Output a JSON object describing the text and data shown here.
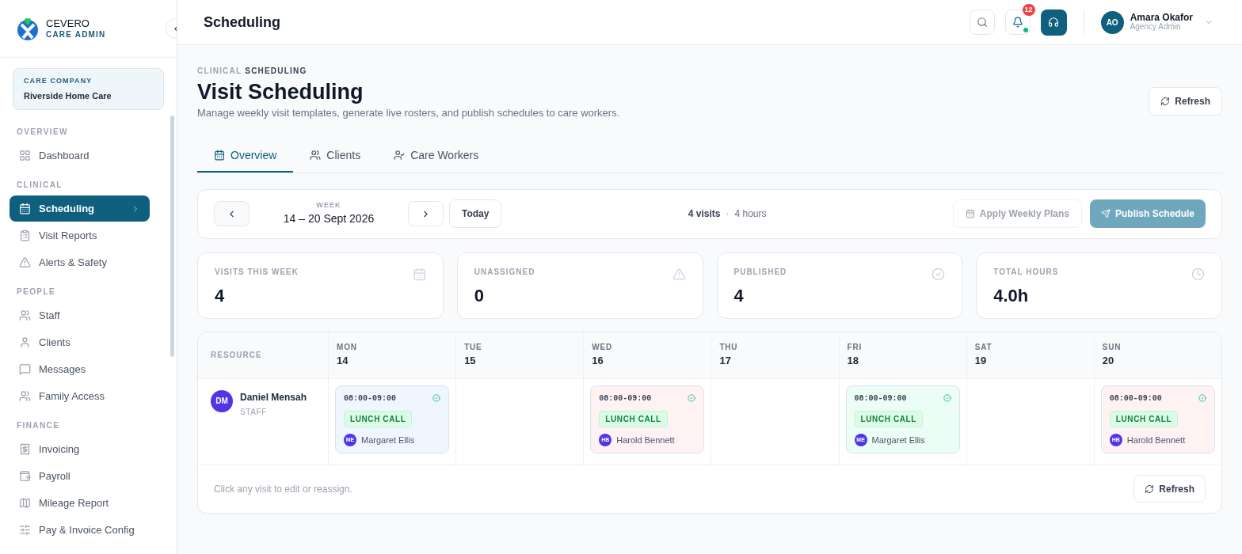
{
  "brand": {
    "name": "CEVERO",
    "subtitle": "CARE ADMIN"
  },
  "company": {
    "label": "CARE COMPANY",
    "name": "Riverside Home Care"
  },
  "sidebar": {
    "sections": [
      {
        "title": "OVERVIEW",
        "items": [
          {
            "label": "Dashboard",
            "selected": false
          }
        ]
      },
      {
        "title": "CLINICAL",
        "items": [
          {
            "label": "Scheduling",
            "selected": true
          },
          {
            "label": "Visit Reports",
            "selected": false
          },
          {
            "label": "Alerts & Safety",
            "selected": false
          }
        ]
      },
      {
        "title": "PEOPLE",
        "items": [
          {
            "label": "Staff",
            "selected": false
          },
          {
            "label": "Clients",
            "selected": false
          },
          {
            "label": "Messages",
            "selected": false
          },
          {
            "label": "Family Access",
            "selected": false
          }
        ]
      },
      {
        "title": "FINANCE",
        "items": [
          {
            "label": "Invoicing",
            "selected": false
          },
          {
            "label": "Payroll",
            "selected": false
          },
          {
            "label": "Mileage Report",
            "selected": false
          },
          {
            "label": "Pay & Invoice Config",
            "selected": false
          }
        ]
      }
    ]
  },
  "header": {
    "title": "Scheduling",
    "notification_count": "12",
    "user": {
      "initials": "AO",
      "name": "Amara Okafor",
      "role": "Agency Admin"
    }
  },
  "page": {
    "breadcrumb": [
      "CLINICAL",
      "SCHEDULING"
    ],
    "title": "Visit Scheduling",
    "subtitle": "Manage weekly visit templates, generate live rosters, and publish schedules to care workers.",
    "refresh": "Refresh"
  },
  "tabs": [
    {
      "label": "Overview",
      "selected": true
    },
    {
      "label": "Clients",
      "selected": false
    },
    {
      "label": "Care Workers",
      "selected": false
    }
  ],
  "week_bar": {
    "label": "WEEK",
    "range": "14 – 20 Sept 2026",
    "today": "Today",
    "visits": "4 visits",
    "separator": "·",
    "hours": "4 hours",
    "apply": "Apply Weekly Plans",
    "publish": "Publish Schedule"
  },
  "stats": [
    {
      "label": "VISITS THIS WEEK",
      "value": "4"
    },
    {
      "label": "UNASSIGNED",
      "value": "0"
    },
    {
      "label": "PUBLISHED",
      "value": "4"
    },
    {
      "label": "TOTAL HOURS",
      "value": "4.0h"
    }
  ],
  "roster": {
    "resource_heading": "RESOURCE",
    "days": [
      {
        "day": "MON",
        "date": "14"
      },
      {
        "day": "TUE",
        "date": "15"
      },
      {
        "day": "WED",
        "date": "16"
      },
      {
        "day": "THU",
        "date": "17"
      },
      {
        "day": "FRI",
        "date": "18"
      },
      {
        "day": "SAT",
        "date": "19"
      },
      {
        "day": "SUN",
        "date": "20"
      }
    ],
    "rows": [
      {
        "initials": "DM",
        "name": "Daniel Mensah",
        "role": "STAFF",
        "cells": [
          {
            "visit": {
              "time": "08:00-09:00",
              "tag": "LUNCH CALL",
              "client_initials": "ME",
              "client": "Margaret Ellis",
              "color": "#eff6ff"
            }
          },
          {},
          {
            "visit": {
              "time": "08:00-09:00",
              "tag": "LUNCH CALL",
              "client_initials": "HB",
              "client": "Harold Bennett",
              "color": "#fef2f2"
            }
          },
          {},
          {
            "visit": {
              "time": "08:00-09:00",
              "tag": "LUNCH CALL",
              "client_initials": "ME",
              "client": "Margaret Ellis",
              "color": "#ecfdf5"
            }
          },
          {},
          {
            "visit": {
              "time": "08:00-09:00",
              "tag": "LUNCH CALL",
              "client_initials": "HB",
              "client": "Harold Bennett",
              "color": "#fef2f2"
            }
          }
        ]
      }
    ],
    "hint": "Click any visit to edit or reassign.",
    "refresh": "Refresh"
  }
}
